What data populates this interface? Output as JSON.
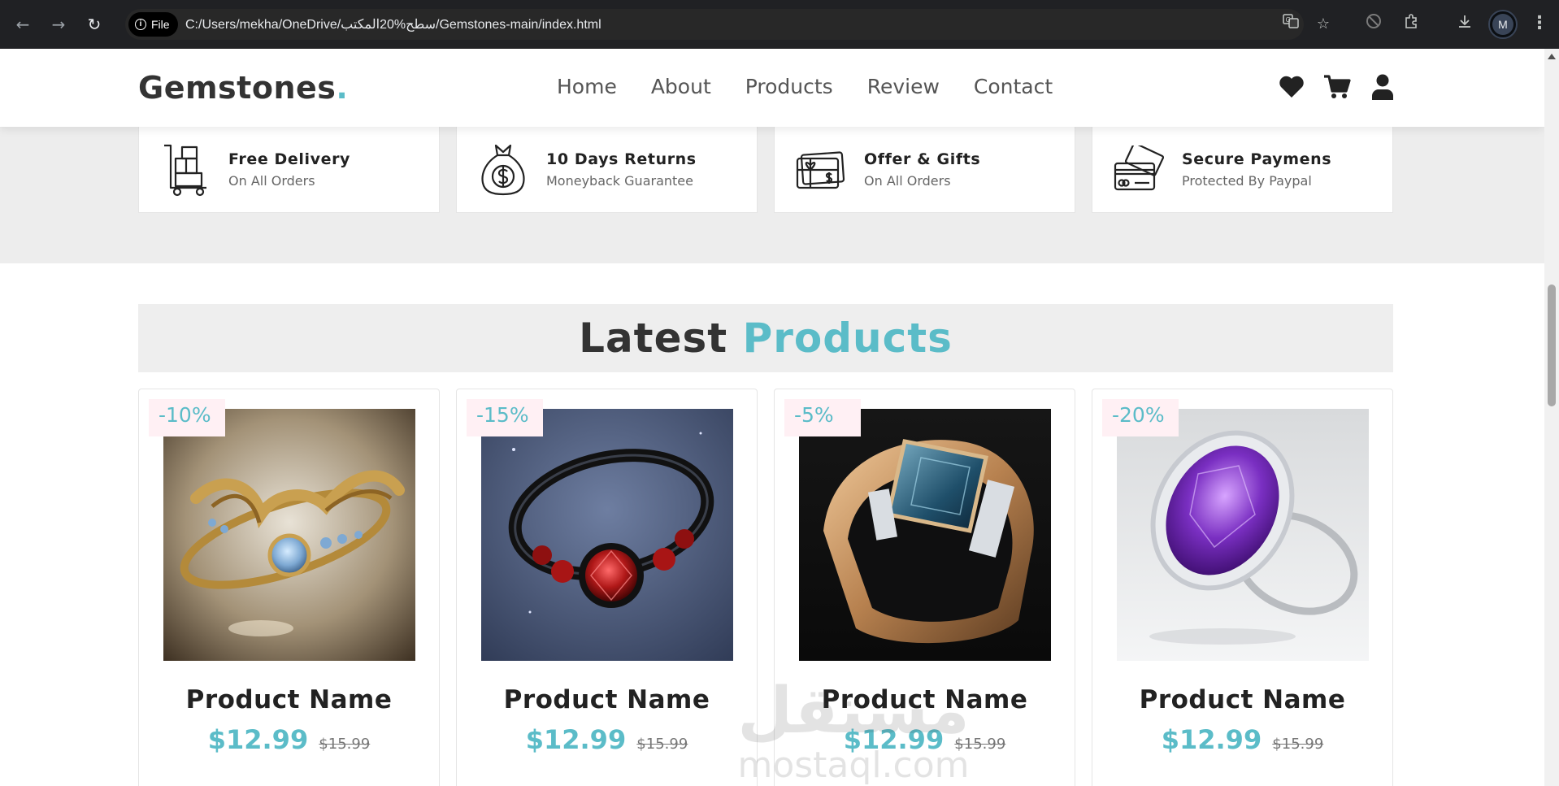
{
  "browser": {
    "file_chip": "File",
    "url": "C:/Users/mekha/OneDrive/سطح%20المكتب/Gemstones-main/index.html",
    "profile_initial": "M"
  },
  "site": {
    "logo_text": "Gemstones",
    "logo_dot": ".",
    "nav": [
      "Home",
      "About",
      "Products",
      "Review",
      "Contact"
    ],
    "accent_color": "#5bbcc8"
  },
  "features": [
    {
      "title": "Free Delivery",
      "subtitle": "On All Orders",
      "icon": "delivery-cart-icon"
    },
    {
      "title": "10 Days Returns",
      "subtitle": "Moneyback Guarantee",
      "icon": "money-bag-icon"
    },
    {
      "title": "Offer & Gifts",
      "subtitle": "On All Orders",
      "icon": "gift-card-icon"
    },
    {
      "title": "Secure Paymens",
      "subtitle": "Protected By Paypal",
      "icon": "credit-card-icon"
    }
  ],
  "products_section": {
    "heading_main": "Latest",
    "heading_accent": "Products",
    "items": [
      {
        "discount": "-10%",
        "name": "Product Name",
        "price": "$12.99",
        "old_price": "$15.99",
        "image": "gold-ring-blue-gem"
      },
      {
        "discount": "-15%",
        "name": "Product Name",
        "price": "$12.99",
        "old_price": "$15.99",
        "image": "black-ring-red-gem"
      },
      {
        "discount": "-5%",
        "name": "Product Name",
        "price": "$12.99",
        "old_price": "$15.99",
        "image": "gold-ring-blue-square-gem"
      },
      {
        "discount": "-20%",
        "name": "Product Name",
        "price": "$12.99",
        "old_price": "$15.99",
        "image": "silver-ring-purple-gem"
      }
    ]
  },
  "watermark": {
    "arabic": "مستقل",
    "latin": "mostaql.com"
  }
}
